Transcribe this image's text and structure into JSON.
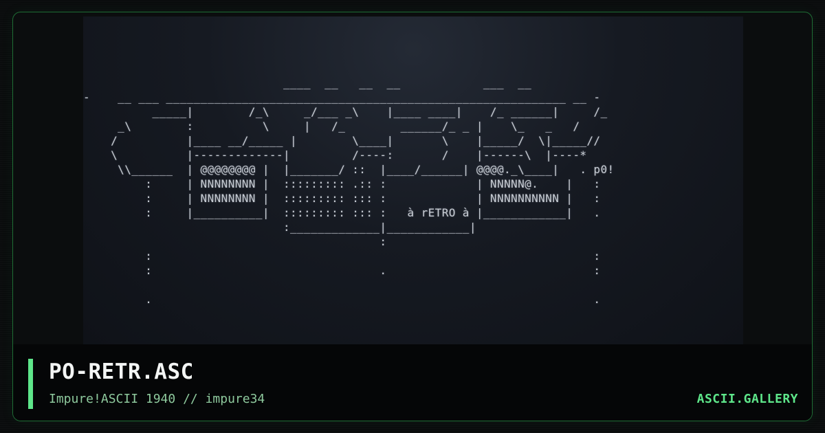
{
  "artwork": {
    "ascii_text": "                             ____  __   __  __            ___  __\n-    __ ___ __________________________________________________________ __ -\n          _____|        /_\\     _/___ _\\    |____ ____|    /_ ______|     /_\n     _\\        :          \\     |   /_        ______/_ _ |    \\_   _   /  \n    /          |____ __/_____ |        \\____|       \\    |_____/  \\|_____//\n    \\          |-------------|         /----:       /    |------\\  |----*\n     \\\\______  | @@@@@@@@ |  |_______/ ::  |____/______| @@@@._\\____|   . p0!\n         :     | NNNNNNNN |  ::::::::: .:: :             | NNNNN@.    |   :\n         :     | NNNNNNNN |  ::::::::: ::: :             | NNNNNNNNNN |   :\n         :     |__________|  ::::::::: ::: :   à rETRO à |____________|   .\n                             :_____________|____________|\n                                           :\n         :                                                                :\n         :                                 .                              :\n\n         .                                                                ."
  },
  "footer": {
    "title": "PO-RETR.ASC",
    "subtitle": "Impure!ASCII 1940 // impure34",
    "brand": "ASCII.GALLERY"
  },
  "colors": {
    "accent": "#5ee68a",
    "border": "#1f6e35",
    "subtitle": "#8ec99d",
    "background": "#0a0c0d"
  }
}
